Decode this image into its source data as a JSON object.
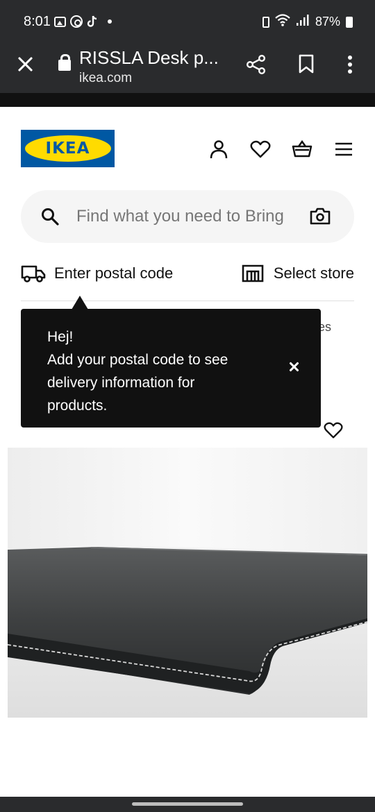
{
  "status_bar": {
    "time": "8:01",
    "battery": "87%",
    "icons": [
      "gallery-icon",
      "threads-icon",
      "tiktok-icon",
      "notification-dot-icon",
      "battery-saver-icon",
      "wifi-icon",
      "signal-icon",
      "battery-icon"
    ]
  },
  "browser": {
    "title": "RISSLA Desk p...",
    "url": "ikea.com",
    "icons": [
      "close-icon",
      "lock-icon",
      "share-icon",
      "bookmark-icon",
      "more-vert-icon"
    ]
  },
  "header": {
    "logo_text": "IKEA",
    "icons": [
      "user-icon",
      "heart-icon",
      "basket-icon",
      "menu-icon"
    ]
  },
  "search": {
    "placeholder": "Find what you need to Bring",
    "icons": [
      "search-icon",
      "camera-icon"
    ]
  },
  "location": {
    "postal_label": "Enter postal code",
    "store_label": "Select store"
  },
  "behind_tooltip_text": "es",
  "tooltip": {
    "title": "Hej!",
    "body": "Add your postal code to see delivery information for products."
  },
  "colors": {
    "ikea_blue": "#0058a3",
    "ikea_yellow": "#ffdb00",
    "tooltip_bg": "#111111",
    "chrome_bg": "#2a2b2d"
  }
}
